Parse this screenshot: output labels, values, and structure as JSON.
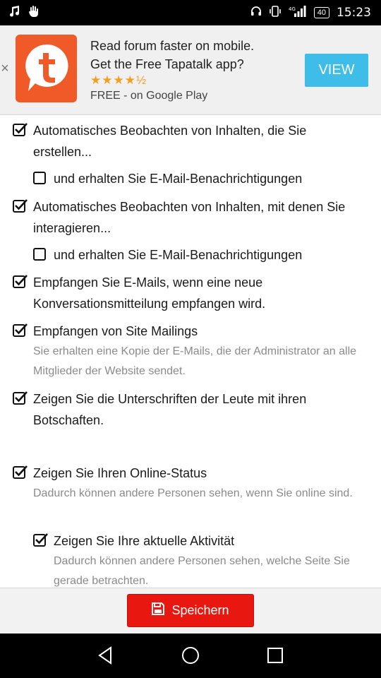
{
  "status_bar": {
    "time": "15:23",
    "battery": "40",
    "left_icons": [
      "music-note-icon",
      "hand-icon"
    ],
    "right_icons": [
      "headset-icon",
      "vibrate-icon",
      "signal-icon"
    ]
  },
  "ad": {
    "line1": "Read forum faster on mobile.",
    "line2": "Get the Free Tapatalk app?",
    "stars": "★★★★½",
    "rating": 4.5,
    "subtitle": "FREE - on Google Play",
    "view_label": "VIEW",
    "close_label": "×",
    "logo_letter": "t",
    "accent": "#f05a28",
    "button_color": "#3fbde9"
  },
  "settings": [
    {
      "label": "Automatisches Beobachten von Inhalten, die Sie erstellen...",
      "checked": true
    },
    {
      "label": "und erhalten Sie E-Mail-Benachrichtigungen",
      "checked": false
    },
    {
      "label": "Automatisches Beobachten von Inhalten, mit denen Sie interagieren...",
      "checked": true
    },
    {
      "label": "und erhalten Sie E-Mail-Benachrichtigungen",
      "checked": false
    },
    {
      "label": "Empfangen Sie E-Mails, wenn eine neue Konversationsmitteilung empfangen wird.",
      "checked": true
    },
    {
      "label": "Empfangen von Site Mailings",
      "hint": "Sie erhalten eine Kopie der E-Mails, die der Administrator an alle Mitglieder der Website sendet.",
      "checked": true
    },
    {
      "label": "Zeigen Sie die Unterschriften der Leute mit ihren Botschaften.",
      "checked": true
    },
    {
      "label": "Zeigen Sie Ihren Online-Status",
      "hint": "Dadurch können andere Personen sehen, wenn Sie online sind.",
      "checked": true
    },
    {
      "label": "Zeigen Sie Ihre aktuelle Aktivität",
      "hint": "Dadurch können andere Personen sehen, welche Seite Sie gerade betrachten.",
      "checked": true
    }
  ],
  "save": {
    "label": "Speichern",
    "icon": "floppy-disk-icon",
    "color": "#e8170f"
  },
  "nav": [
    "back-icon",
    "home-icon",
    "recents-icon"
  ]
}
